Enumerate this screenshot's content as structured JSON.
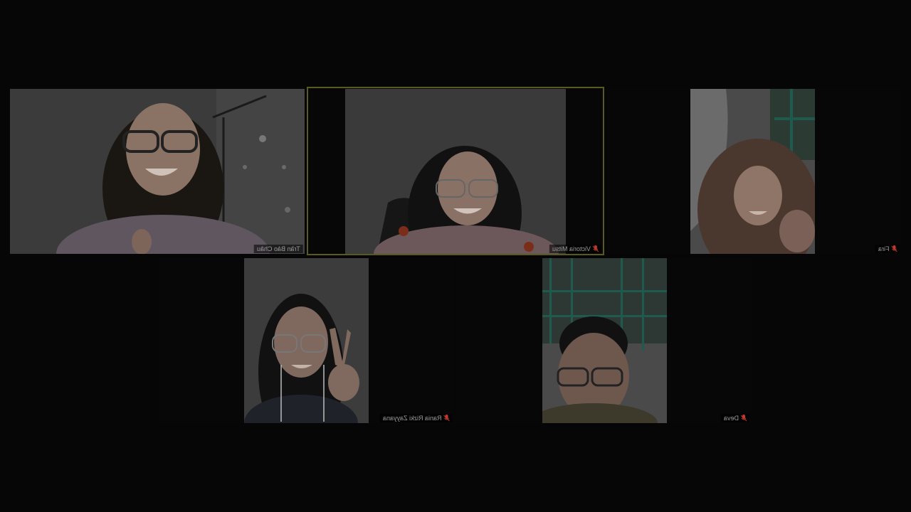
{
  "meeting": {
    "active_speaker": "Victoria Mitsu"
  },
  "participants": [
    {
      "id": "p1",
      "name": "Trần Bảo Châu",
      "muted": false
    },
    {
      "id": "p2",
      "name": "Victoria Mitsu",
      "muted": true
    },
    {
      "id": "p3",
      "name": "Fira",
      "muted": true
    },
    {
      "id": "p4",
      "name": "Rania Rizki Zayyana",
      "muted": true
    },
    {
      "id": "p5",
      "name": "Deva",
      "muted": true
    }
  ],
  "colors": {
    "active_border": "#5a5a1e",
    "muted_mic": "#c0392b",
    "tile_bg": "#0b0b0b"
  }
}
